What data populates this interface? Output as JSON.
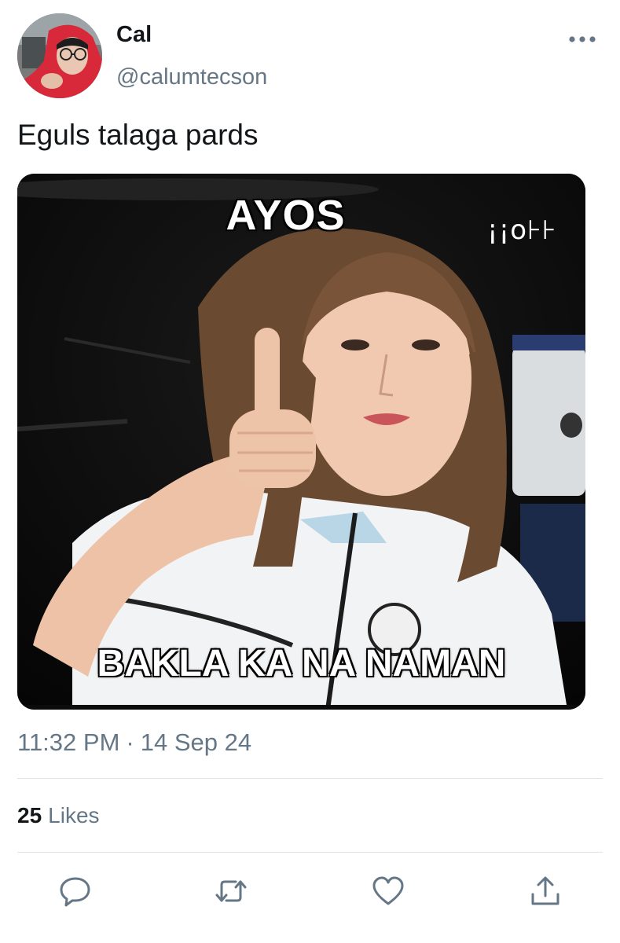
{
  "author": {
    "display_name": "Cal",
    "handle": "@calumtecson",
    "avatar_icon": "avatar-photo"
  },
  "tweet": {
    "text": "Eguls talaga pards",
    "media": {
      "top_caption": "AYOS",
      "bottom_caption": "BAKLA KA NA NAMAN",
      "watermark": "¡¡o⊦⊦"
    },
    "time": "11:32 PM",
    "separator": "·",
    "date": "14 Sep 24"
  },
  "stats": {
    "likes_count": "25",
    "likes_label": "Likes"
  },
  "actions": {
    "more_icon": "more-icon",
    "reply_icon": "reply-icon",
    "retweet_icon": "retweet-icon",
    "like_icon": "like-icon",
    "share_icon": "share-icon"
  },
  "colors": {
    "text_primary": "#14171a",
    "text_secondary": "#657786",
    "divider": "#dfe3e6",
    "icon": "#657786"
  }
}
